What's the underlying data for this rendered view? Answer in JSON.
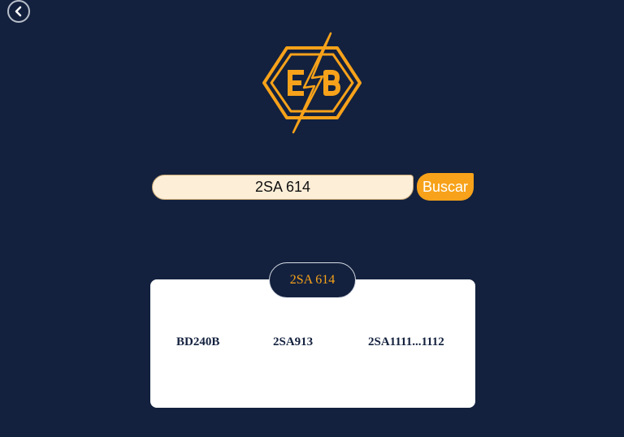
{
  "search": {
    "value": "2SA 614",
    "button_label": "Buscar"
  },
  "results": {
    "title": "2SA 614",
    "items": [
      {
        "label": "BD240B"
      },
      {
        "label": "2SA913"
      },
      {
        "label": "2SA1111...1112"
      }
    ]
  },
  "colors": {
    "background": "#13213e",
    "accent": "#f7a21a",
    "input_background": "#fdeed7",
    "card": "#ffffff"
  },
  "icons": {
    "back": "chevron-left-icon",
    "logo": "eb-lightning-hexagon-logo"
  }
}
